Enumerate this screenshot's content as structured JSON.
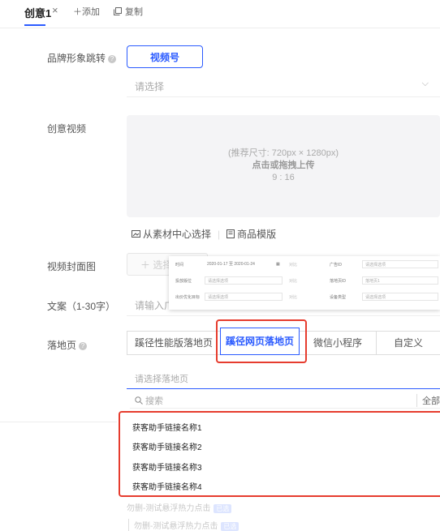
{
  "tabs": {
    "active": "创意1",
    "close": "×",
    "add": "＋添加",
    "copy_icon": "copy-icon",
    "copy": "复制"
  },
  "brand": {
    "label": "品牌形象跳转",
    "button": "视频号",
    "select_placeholder": "请选择",
    "chevron": "⌵"
  },
  "video": {
    "label": "创意视频",
    "hint_size": "(推荐尺寸: 720px × 1280px)",
    "hint_action": "点击或拖拽上传",
    "hint_ratio": "9 : 16",
    "link_library": "从素材中心选择",
    "link_template": "商品模版"
  },
  "cover": {
    "label": "视频封面图",
    "button": "＋ 选择"
  },
  "copy_text": {
    "label": "文案（1-30字）",
    "placeholder": "请输入广"
  },
  "popup": {
    "rows": [
      {
        "k1": "时间",
        "v1": "2020-01-17 至 2020-01-24",
        "c1": "对比",
        "k2": "广告ID",
        "v2": "请选择选项"
      },
      {
        "k1": "投放版位",
        "v1": "请选择选项",
        "c1": "对比",
        "k2": "落地页ID",
        "v2": "落地页1"
      },
      {
        "k1": "出价优化目标",
        "v1": "请选择选项",
        "c1": "对比",
        "k2": "设备类型",
        "v2": "请选择选项"
      }
    ]
  },
  "landing": {
    "label": "落地页",
    "segments": [
      "蹊径性能版落地页",
      "蹊径网页落地页",
      "微信小程序",
      "自定义"
    ],
    "select_placeholder": "请选择落地页",
    "search_placeholder": "搜索",
    "search_all": "全部",
    "items": [
      "获客助手链接名称1",
      "获客助手链接名称2",
      "获客助手链接名称3",
      "获客助手链接名称4"
    ],
    "faded": [
      {
        "text": "勿删-测试悬浮热力点击",
        "tag": "已选"
      },
      {
        "text": "勿删-测试悬浮热力点击",
        "tag": "已选"
      }
    ]
  },
  "colors": {
    "accent": "#2b5bff",
    "highlight": "#e63c2e"
  }
}
